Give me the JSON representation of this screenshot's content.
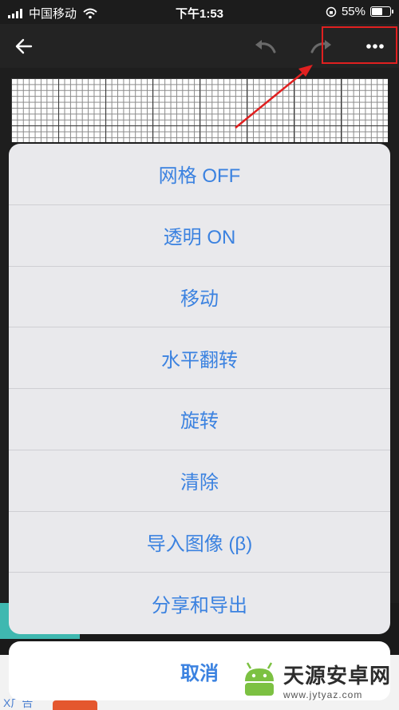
{
  "status_bar": {
    "carrier": "中国移动",
    "time": "下午1:53",
    "battery": "55%",
    "battery_level": 55
  },
  "toolbar": {
    "icons": [
      "back-arrow-icon",
      "undo-icon",
      "redo-icon",
      "more-icon"
    ]
  },
  "menu": {
    "items": [
      {
        "label": "网格 OFF"
      },
      {
        "label": "透明 ON"
      },
      {
        "label": "移动"
      },
      {
        "label": "水平翻转"
      },
      {
        "label": "旋转"
      },
      {
        "label": "清除"
      },
      {
        "label": "导入图像 (β)"
      },
      {
        "label": "分享和导出"
      }
    ],
    "cancel": "取消"
  },
  "ad": {
    "close_label": "X广告"
  },
  "watermark": {
    "title": "天源安卓网",
    "url": "www.jytyaz.com"
  },
  "colors": {
    "accent": "#3b82e0",
    "highlight": "#e02020"
  }
}
